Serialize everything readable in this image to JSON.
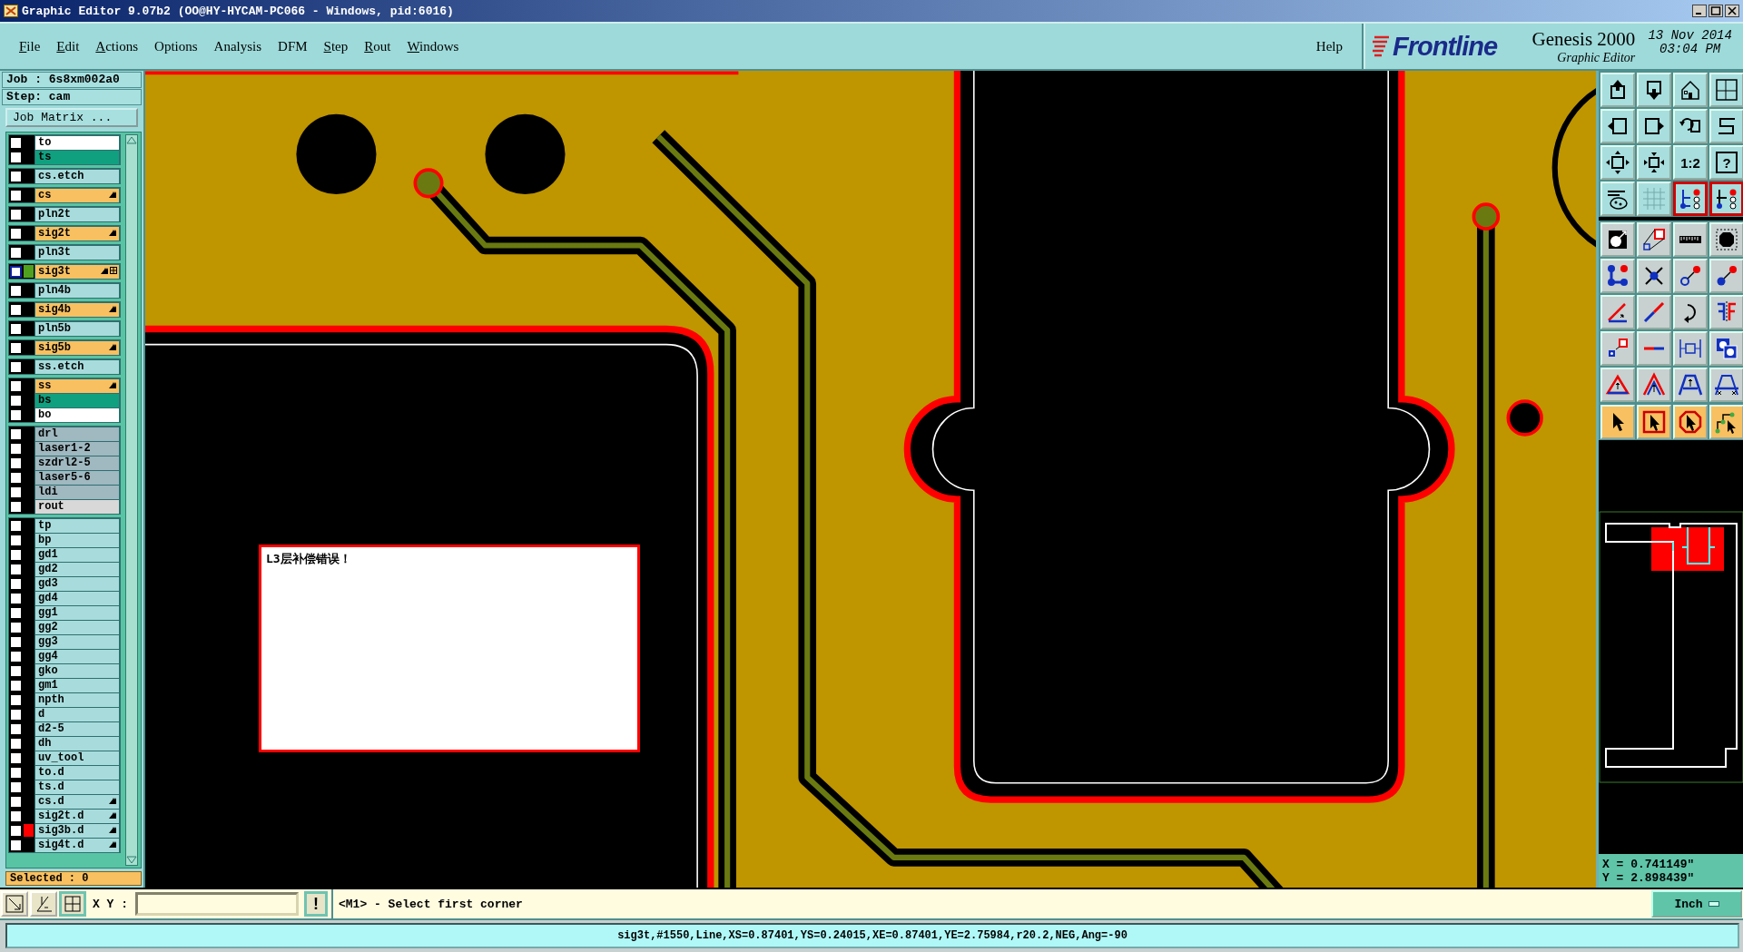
{
  "window": {
    "title": "Graphic Editor 9.07b2 (OO@HY-HYCAM-PC066 - Windows, pid:6016)"
  },
  "menu": [
    {
      "label": "File",
      "underlined": true
    },
    {
      "label": "Edit",
      "underlined": true
    },
    {
      "label": "Actions",
      "underlined": true
    },
    {
      "label": "Options",
      "underlined": false
    },
    {
      "label": "Analysis",
      "underlined": false
    },
    {
      "label": "DFM",
      "underlined": false
    },
    {
      "label": "Step",
      "underlined": true
    },
    {
      "label": "Rout",
      "underlined": true
    },
    {
      "label": "Windows",
      "underlined": true
    }
  ],
  "help": "Help",
  "brand": {
    "logo": "Frontline",
    "product": "Genesis 2000",
    "subtitle": "Graphic Editor",
    "date": "13 Nov 2014",
    "time": "03:04 PM"
  },
  "job": {
    "job_line": "Job : 6s8xm002a0",
    "step_line": "Step: cam",
    "matrix_button": "Job Matrix ..."
  },
  "layer_groups": [
    [
      {
        "name": "to",
        "color": "#ffffff",
        "checked": false,
        "work": false,
        "hand": false
      },
      {
        "name": "ts",
        "color": "#10a080",
        "checked": false,
        "work": false,
        "hand": false
      }
    ],
    [
      {
        "name": "cs.etch",
        "color": "#a8dcdc",
        "checked": false,
        "work": false,
        "hand": false
      }
    ],
    [
      {
        "name": "cs",
        "color": "#f8c060",
        "checked": false,
        "work": false,
        "hand": true
      }
    ],
    [
      {
        "name": "pln2t",
        "color": "#a8dcdc",
        "checked": false,
        "work": false,
        "hand": false
      }
    ],
    [
      {
        "name": "sig2t",
        "color": "#f8c060",
        "checked": false,
        "work": false,
        "hand": true
      }
    ],
    [
      {
        "name": "pln3t",
        "color": "#a8dcdc",
        "checked": false,
        "work": false,
        "hand": false
      }
    ],
    [
      {
        "name": "sig3t",
        "color": "#f8c060",
        "swatch": {
          "color": "#50a020"
        },
        "checked": false,
        "work": true,
        "hand": true
      }
    ],
    [
      {
        "name": "pln4b",
        "color": "#a8dcdc",
        "checked": false,
        "work": false,
        "hand": false
      }
    ],
    [
      {
        "name": "sig4b",
        "color": "#f8c060",
        "checked": false,
        "work": false,
        "hand": true
      }
    ],
    [
      {
        "name": "pln5b",
        "color": "#a8dcdc",
        "checked": false,
        "work": false,
        "hand": false
      }
    ],
    [
      {
        "name": "sig5b",
        "color": "#f8c060",
        "checked": false,
        "work": false,
        "hand": true
      }
    ],
    [
      {
        "name": "ss.etch",
        "color": "#a8dcdc",
        "checked": false,
        "work": false,
        "hand": false
      }
    ],
    [
      {
        "name": "ss",
        "color": "#f8c060",
        "checked": false,
        "work": false,
        "hand": true
      },
      {
        "name": "bs",
        "color": "#10a080",
        "checked": false,
        "work": false,
        "hand": false
      },
      {
        "name": "bo",
        "color": "#ffffff",
        "checked": false,
        "work": false,
        "hand": false
      }
    ],
    [
      {
        "name": "drl",
        "color": "#a0b8c0",
        "checked": false,
        "work": false,
        "hand": false
      },
      {
        "name": "laser1-2",
        "color": "#a0b8c0",
        "checked": false,
        "work": false,
        "hand": false
      },
      {
        "name": "szdrl2-5",
        "color": "#a0b8c0",
        "checked": false,
        "work": false,
        "hand": false
      },
      {
        "name": "laser5-6",
        "color": "#a0b8c0",
        "checked": false,
        "work": false,
        "hand": false
      },
      {
        "name": "ldi",
        "color": "#a0b8c0",
        "checked": false,
        "work": false,
        "hand": false
      },
      {
        "name": "rout",
        "color": "#d8d8d8",
        "checked": false,
        "work": false,
        "hand": false
      }
    ],
    [
      {
        "name": "tp",
        "color": "#a8dcdc",
        "checked": false,
        "work": false,
        "hand": false
      },
      {
        "name": "bp",
        "color": "#a8dcdc",
        "checked": false,
        "work": false,
        "hand": false
      },
      {
        "name": "gd1",
        "color": "#a8dcdc",
        "checked": false,
        "work": false,
        "hand": false
      },
      {
        "name": "gd2",
        "color": "#a8dcdc",
        "checked": false,
        "work": false,
        "hand": false
      },
      {
        "name": "gd3",
        "color": "#a8dcdc",
        "checked": false,
        "work": false,
        "hand": false
      },
      {
        "name": "gd4",
        "color": "#a8dcdc",
        "checked": false,
        "work": false,
        "hand": false
      },
      {
        "name": "gg1",
        "color": "#a8dcdc",
        "checked": false,
        "work": false,
        "hand": false
      },
      {
        "name": "gg2",
        "color": "#a8dcdc",
        "checked": false,
        "work": false,
        "hand": false
      },
      {
        "name": "gg3",
        "color": "#a8dcdc",
        "checked": false,
        "work": false,
        "hand": false
      },
      {
        "name": "gg4",
        "color": "#a8dcdc",
        "checked": false,
        "work": false,
        "hand": false
      },
      {
        "name": "gko",
        "color": "#a8dcdc",
        "checked": false,
        "work": false,
        "hand": false
      },
      {
        "name": "gm1",
        "color": "#a8dcdc",
        "checked": false,
        "work": false,
        "hand": false
      },
      {
        "name": "npth",
        "color": "#a8dcdc",
        "checked": false,
        "work": false,
        "hand": false
      },
      {
        "name": "d",
        "color": "#a8dcdc",
        "checked": false,
        "work": false,
        "hand": false
      },
      {
        "name": "d2-5",
        "color": "#a8dcdc",
        "checked": false,
        "work": false,
        "hand": false
      },
      {
        "name": "dh",
        "color": "#a8dcdc",
        "checked": false,
        "work": false,
        "hand": false
      },
      {
        "name": "uv_tool",
        "color": "#a8dcdc",
        "checked": false,
        "work": false,
        "hand": false
      },
      {
        "name": "to.d",
        "color": "#a8dcdc",
        "checked": false,
        "work": false,
        "hand": false
      },
      {
        "name": "ts.d",
        "color": "#a8dcdc",
        "checked": false,
        "work": false,
        "hand": false
      },
      {
        "name": "cs.d",
        "color": "#a8dcdc",
        "checked": false,
        "work": false,
        "hand": true
      },
      {
        "name": "sig2t.d",
        "color": "#a8dcdc",
        "checked": false,
        "work": false,
        "hand": true
      },
      {
        "name": "sig3b.d",
        "color": "#a8dcdc",
        "swatch": {
          "color": "#ff0000"
        },
        "checked": false,
        "work": false,
        "hand": true
      },
      {
        "name": "sig4t.d",
        "color": "#a8dcdc",
        "checked": false,
        "work": false,
        "hand": true
      }
    ]
  ],
  "selected_count": "Selected : 0",
  "canvas": {
    "message": "L3层补偿错误！"
  },
  "toolbox": {
    "groups": [
      {
        "kind": "view",
        "buttons": [
          {
            "on": false
          },
          {
            "on": false
          },
          {
            "on": false
          },
          {
            "on": false
          },
          {
            "on": false
          },
          {
            "on": false
          },
          {
            "on": false
          },
          {
            "on": false
          },
          {
            "on": false
          },
          {
            "on": false
          },
          {
            "on": false,
            "label": "1:2"
          },
          {
            "on": false,
            "label": "?"
          },
          {
            "on": false
          },
          {
            "on": false
          },
          {
            "on": true
          },
          {
            "on": true
          }
        ]
      },
      {
        "kind": "edit",
        "buttons": [
          {
            "on": false
          },
          {
            "on": false
          },
          {
            "on": false
          },
          {
            "on": false
          },
          {
            "on": false
          },
          {
            "on": false
          },
          {
            "on": false
          },
          {
            "on": false
          },
          {
            "on": false
          },
          {
            "on": false
          },
          {
            "on": false
          },
          {
            "on": false
          },
          {
            "on": false
          },
          {
            "on": false
          },
          {
            "on": false
          },
          {
            "on": false
          },
          {
            "on": false
          },
          {
            "on": false
          },
          {
            "on": false
          },
          {
            "on": false
          }
        ]
      },
      {
        "kind": "select",
        "buttons": [
          {
            "on": false
          },
          {
            "on": false
          },
          {
            "on": false
          },
          {
            "on": false
          }
        ]
      }
    ]
  },
  "coordinates": {
    "x": "X = 0.741149\"",
    "y": "Y = 2.898439\""
  },
  "command_bar": {
    "xy_label": "X Y :",
    "alert_button": "!",
    "prompt": "<M1> - Select first corner",
    "units": "Inch"
  },
  "status_bar": "sig3t,#1550,Line,XS=0.87401,YS=0.24015,XE=0.87401,YE=2.75984,r20.2,NEG,Ang=-90"
}
